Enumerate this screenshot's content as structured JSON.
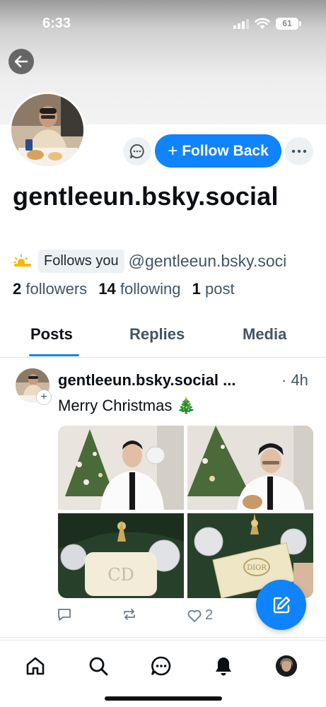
{
  "status_bar": {
    "time": "6:33",
    "battery": "61"
  },
  "profile": {
    "display_name": "gentleeun.bsky.social",
    "follows_you": "Follows you",
    "handle": "@gentleeun.bsky.soci",
    "followers_count": "2",
    "followers_label": "followers",
    "following_count": "14",
    "following_label": "following",
    "posts_count": "1",
    "posts_label": "post"
  },
  "actions": {
    "follow_back_label": "Follow Back",
    "follow_plus": "+"
  },
  "tabs": [
    {
      "label": "Posts",
      "active": true
    },
    {
      "label": "Replies",
      "active": false
    },
    {
      "label": "Media",
      "active": false
    }
  ],
  "post": {
    "author": "gentleeun.bsky.social ...",
    "time": "· 4h",
    "text": "Merry Christmas 🎄",
    "like_count": "2"
  },
  "colors": {
    "accent": "#1083fe",
    "muted": "#435465",
    "divider": "#e4e8ec"
  },
  "icons": [
    "back-arrow-icon",
    "message-icon",
    "more-dots-icon",
    "reply-icon",
    "repost-icon",
    "heart-icon",
    "compose-icon",
    "home-icon",
    "search-icon",
    "chat-icon",
    "bell-icon"
  ]
}
